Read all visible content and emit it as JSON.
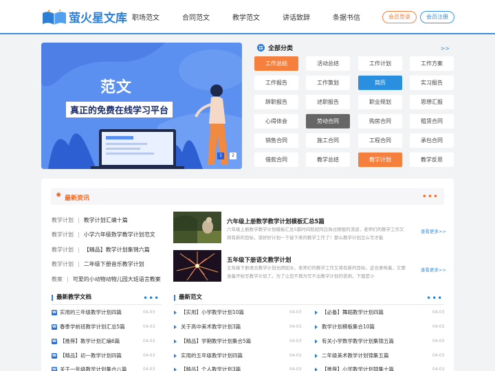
{
  "header": {
    "logo_text": "萤火星文库",
    "nav": [
      "职场范文",
      "合同范文",
      "教学范文",
      "讲话致辞",
      "条据书信"
    ],
    "login": "会员登录",
    "register": "会员注册"
  },
  "banner": {
    "title": "范文",
    "subtitle": "真正的免费在线学习平台",
    "dots": [
      "1",
      "2"
    ]
  },
  "categories": {
    "title": "全部分类",
    "more": ">>",
    "items": [
      "工作总结",
      "活动总结",
      "工作计划",
      "工作方案",
      "工作报告",
      "工作策划",
      "简历",
      "实习报告",
      "辞职报告",
      "述职报告",
      "职业规划",
      "思想汇报",
      "心得体会",
      "劳动合同",
      "购房合同",
      "租赁合同",
      "销售合同",
      "施工合同",
      "工程合同",
      "承包合同",
      "借款合同",
      "教学总结",
      "教学计划",
      "教学反思"
    ]
  },
  "news": {
    "title": "最新资讯",
    "left_list": [
      {
        "cat": "教学计划",
        "title": "教学计划汇编十篇"
      },
      {
        "cat": "教学计划",
        "title": "小学六年级数学教学计划范文"
      },
      {
        "cat": "教学计划",
        "title": "【精品】教学计划集锦六篇"
      },
      {
        "cat": "教学计划",
        "title": "二年级下册音乐教学计划"
      },
      {
        "cat": "教案",
        "title": "可爱的小动物动物儿园大班语言教案"
      }
    ],
    "articles": [
      {
        "title": "六年级上册数学教学计划模板汇总5篇",
        "desc": "六年级上册数学教学计划模板汇总5篇时间就如同白驹过隙般的流逝，老师们的教学工作又将有新的目标，该好好计划一下接下来的教学工作了！那么教学计划怎么写才能",
        "more": "查看更多>>"
      },
      {
        "title": "五年级下册语文教学计划",
        "desc": "五年级下册语文教学计划光阴如水，老师们的教学工作又将有新的目标，这也意味着，又要准备开始写教学计划了。为了让您不再为写不出教学计划的苦闹，下面是小",
        "more": "查看更多>>"
      }
    ]
  },
  "docs": {
    "title": "最新教学文档",
    "items": [
      {
        "title": "实用的三年级教学计划四篇",
        "date": "04-03"
      },
      {
        "title": "春季学前班教学计划汇总5篇",
        "date": "04-03"
      },
      {
        "title": "【推荐】教学计划汇编6篇",
        "date": "04-03"
      },
      {
        "title": "【精品】初一教学计划四篇",
        "date": "04-03"
      },
      {
        "title": "关于一年级教学计划集合八篇",
        "date": "04-03"
      }
    ]
  },
  "latest": {
    "title": "最新范文",
    "col1": [
      {
        "title": "【实用】小学教学计划10篇",
        "date": "04-03"
      },
      {
        "title": "关于高中美术教学计划3篇",
        "date": "04-03"
      },
      {
        "title": "【精品】学期教学计划集合5篇",
        "date": "04-03"
      },
      {
        "title": "实用的五年级教学计划四篇",
        "date": "04-03"
      },
      {
        "title": "【精品】个人教学计划3篇",
        "date": "04-03"
      }
    ],
    "col2": [
      {
        "title": "【必备】舞蹈教学计划四篇",
        "date": "04-03"
      },
      {
        "title": "教学计划模板集合10篇",
        "date": "04-03"
      },
      {
        "title": "有关小学数学教学计划集锦五篇",
        "date": "04-03"
      },
      {
        "title": "二年级美术教学计划锦集五篇",
        "date": "04-03"
      },
      {
        "title": "【推荐】小学教学计划锦集十篇",
        "date": "04-03"
      }
    ]
  },
  "colors": {
    "brand_blue": "#2b7fd6",
    "accent_orange": "#f5803e"
  }
}
